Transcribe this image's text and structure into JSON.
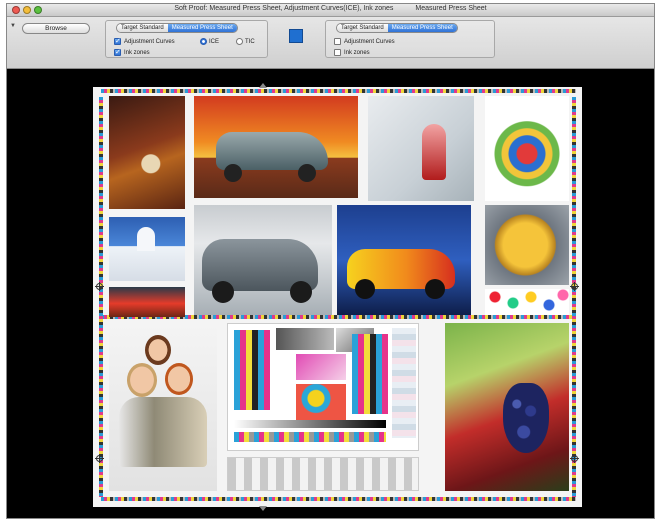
{
  "window": {
    "title_parts": [
      "Soft Proof: Measured Press Sheet, Adjustment Curves(ICE), Ink zones",
      "Measured Press Sheet"
    ]
  },
  "toolbar": {
    "browse_label": "Browse",
    "left_group": {
      "tabs": [
        "Target Standard",
        "Measured Press Sheet"
      ],
      "active_tab": "Measured Press Sheet",
      "adjustment_curves_label": "Adjustment Curves",
      "adjustment_curves_checked": true,
      "radio_ice_label": "ICE",
      "radio_tic_label": "TIC",
      "radio_selected": "ICE",
      "ink_zones_label": "Ink zones",
      "ink_zones_checked": true
    },
    "swatch_color": "#1f6fd0",
    "right_group": {
      "tabs": [
        "Target Standard",
        "Measured Press Sheet"
      ],
      "active_tab": "Measured Press Sheet",
      "adjustment_curves_label": "Adjustment Curves",
      "adjustment_curves_checked": false,
      "ink_zones_label": "Ink zones",
      "ink_zones_checked": false
    }
  },
  "sheet": {
    "images": [
      "clock-on-table",
      "classic-car-red-sky",
      "car-tail-fin",
      "crayons",
      "church-dome",
      "silver-sedan",
      "flame-hot-rod",
      "golden-globe",
      "red-boat",
      "candy-balls",
      "family-portrait",
      "grape-vine"
    ]
  }
}
